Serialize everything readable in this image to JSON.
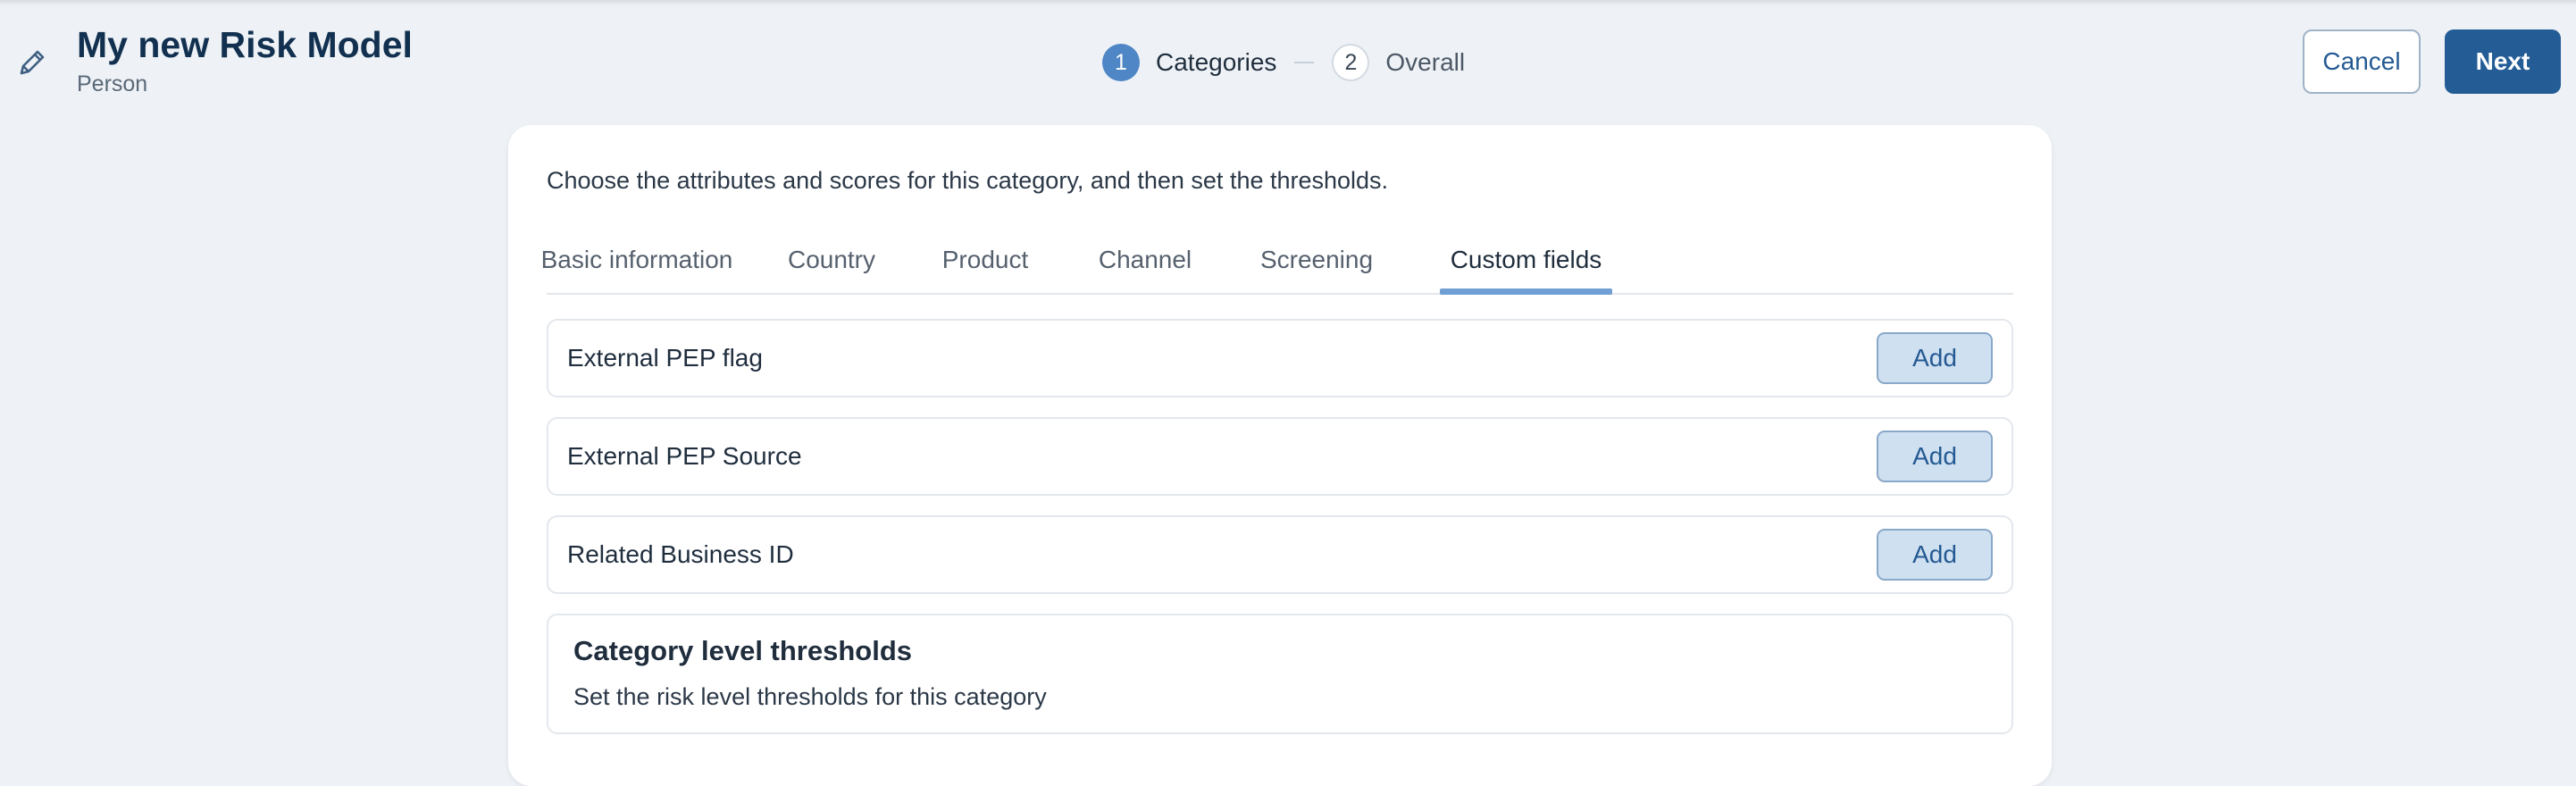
{
  "header": {
    "title": "My new Risk Model",
    "subtitle": "Person",
    "edit_icon": "pencil-icon"
  },
  "stepper": {
    "steps": [
      {
        "number": "1",
        "label": "Categories",
        "active": true
      },
      {
        "number": "2",
        "label": "Overall",
        "active": false
      }
    ]
  },
  "actions": {
    "cancel_label": "Cancel",
    "next_label": "Next"
  },
  "card": {
    "intro": "Choose the attributes and scores for this category, and then set the thresholds.",
    "tabs": [
      {
        "label": "Basic information"
      },
      {
        "label": "Country"
      },
      {
        "label": "Product"
      },
      {
        "label": "Channel"
      },
      {
        "label": "Screening"
      },
      {
        "label": "Custom fields",
        "active": true
      }
    ],
    "fields": [
      {
        "label": "External PEP flag",
        "action": "Add"
      },
      {
        "label": "External PEP Source",
        "action": "Add"
      },
      {
        "label": "Related Business ID",
        "action": "Add"
      }
    ],
    "thresholds": {
      "title": "Category level thresholds",
      "description": "Set the risk level thresholds for this category"
    }
  },
  "colors": {
    "primary": "#245c96",
    "accent": "#4f86c6",
    "tab_indicator": "#6f9fd3",
    "add_button_bg": "#cfe0f1",
    "background": "#eef2f6"
  }
}
